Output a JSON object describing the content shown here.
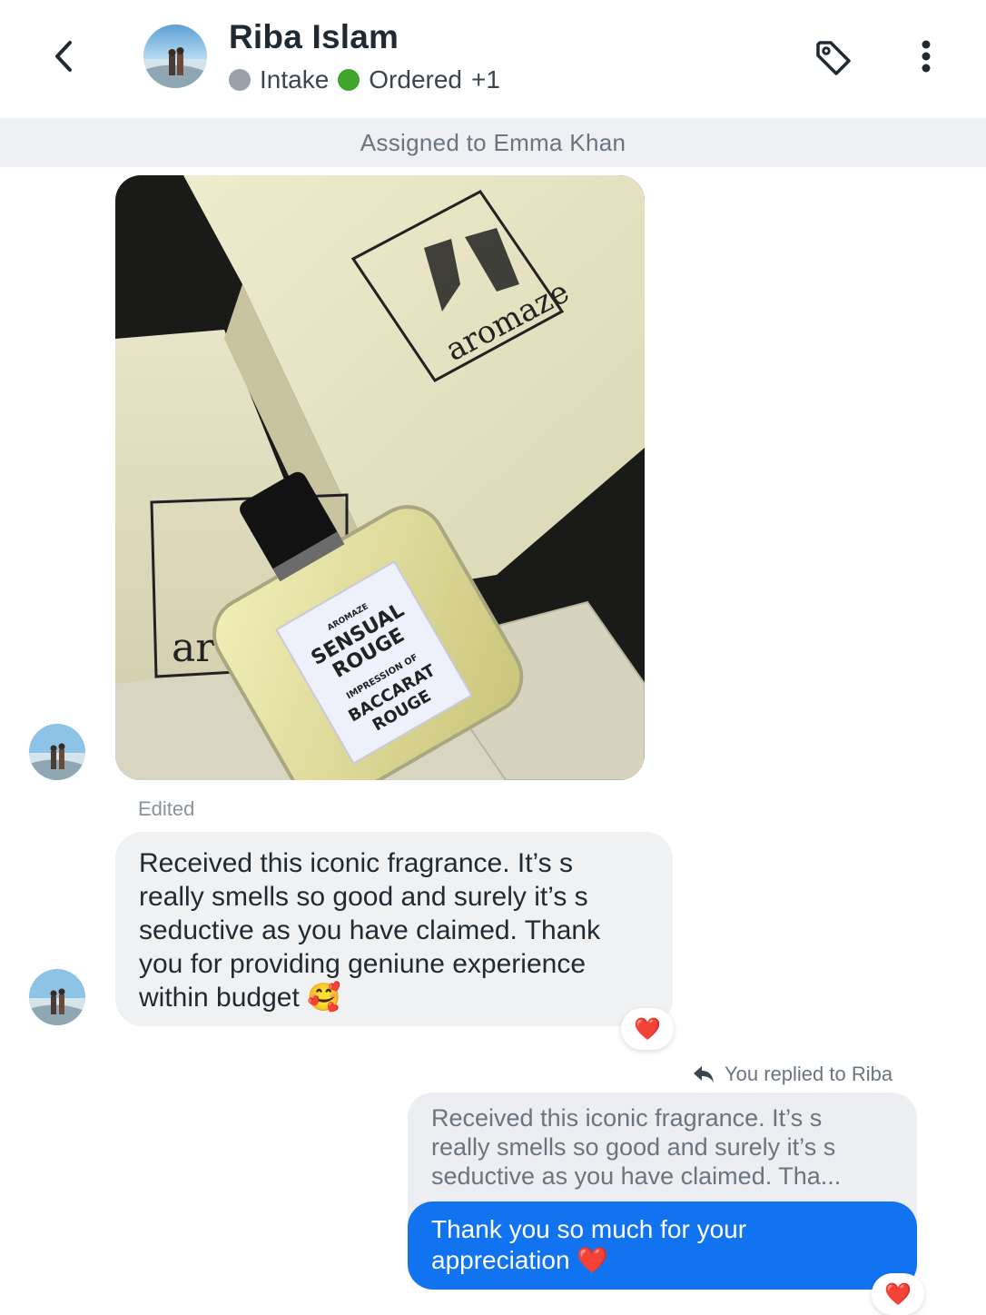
{
  "header": {
    "contact_name": "Riba Islam",
    "tags": [
      {
        "label": "Intake",
        "color": "#9aa0a8"
      },
      {
        "label": "Ordered",
        "color": "#3fa52a"
      }
    ],
    "extra_tags": "+1"
  },
  "assigned_banner": "Assigned to Emma Khan",
  "conversation": {
    "image_message": {
      "brand_text": "aromaze",
      "label_lines": [
        "AROMAZE",
        "SENSUAL",
        "ROUGE",
        "IMPRESSION OF",
        "BACCARAT",
        "ROUGE"
      ]
    },
    "edited_label": "Edited",
    "incoming_message": {
      "lines": [
        "Received  this iconic fragrance. It’s s",
        "really smells so good and surely it’s s",
        "seductive as you have claimed. Thank",
        "you for providing geniune experience",
        "within budget 🥰"
      ],
      "reaction": "❤️"
    },
    "reply_label": "You replied to Riba",
    "quoted_message": {
      "lines": [
        "Received  this iconic fragrance. It’s s",
        "really smells so good and surely it’s s",
        "seductive as you have claimed. Tha..."
      ]
    },
    "outgoing_message": {
      "lines": [
        "Thank you so much for your",
        "appreciation ❤️"
      ],
      "reaction": "❤️"
    }
  }
}
